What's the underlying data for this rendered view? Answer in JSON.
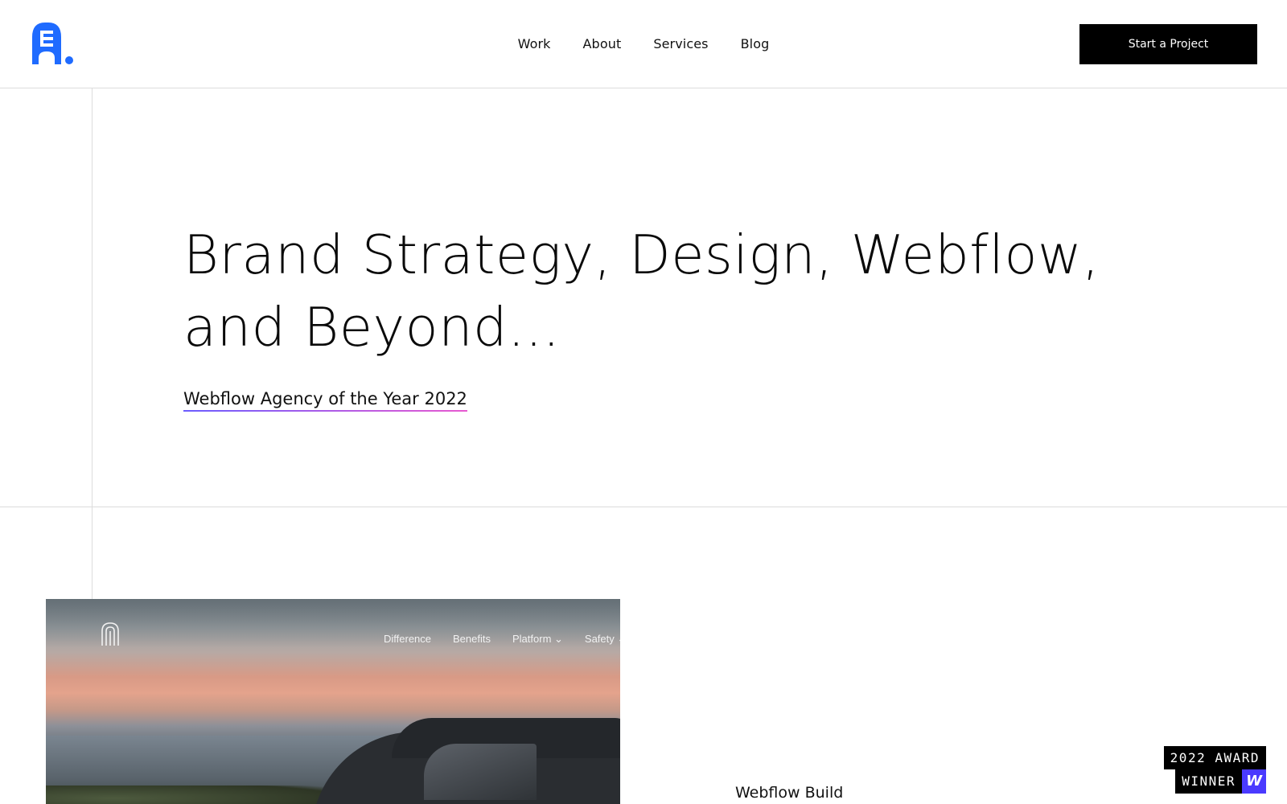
{
  "colors": {
    "brand_blue": "#1f6bff",
    "cta_bg": "#000000",
    "badge_accent": "#4a3aff",
    "link_underline": "#7a5cff"
  },
  "header": {
    "logo_icon": "brand-logo-icon",
    "nav": [
      "Work",
      "About",
      "Services",
      "Blog"
    ],
    "cta_label": "Start a Project"
  },
  "hero": {
    "title_line1": "Brand Strategy, Design, Webflow,",
    "title_line2": "and Beyond...",
    "award_link": "Webflow Agency of the Year 2022"
  },
  "showcase": {
    "nav": [
      "Difference",
      "Benefits",
      "Platform ⌄",
      "Safety ⌄"
    ],
    "caption": "Webflow Build"
  },
  "badge": {
    "line1": "2022 AWARD",
    "line2": "WINNER",
    "icon": "W"
  }
}
